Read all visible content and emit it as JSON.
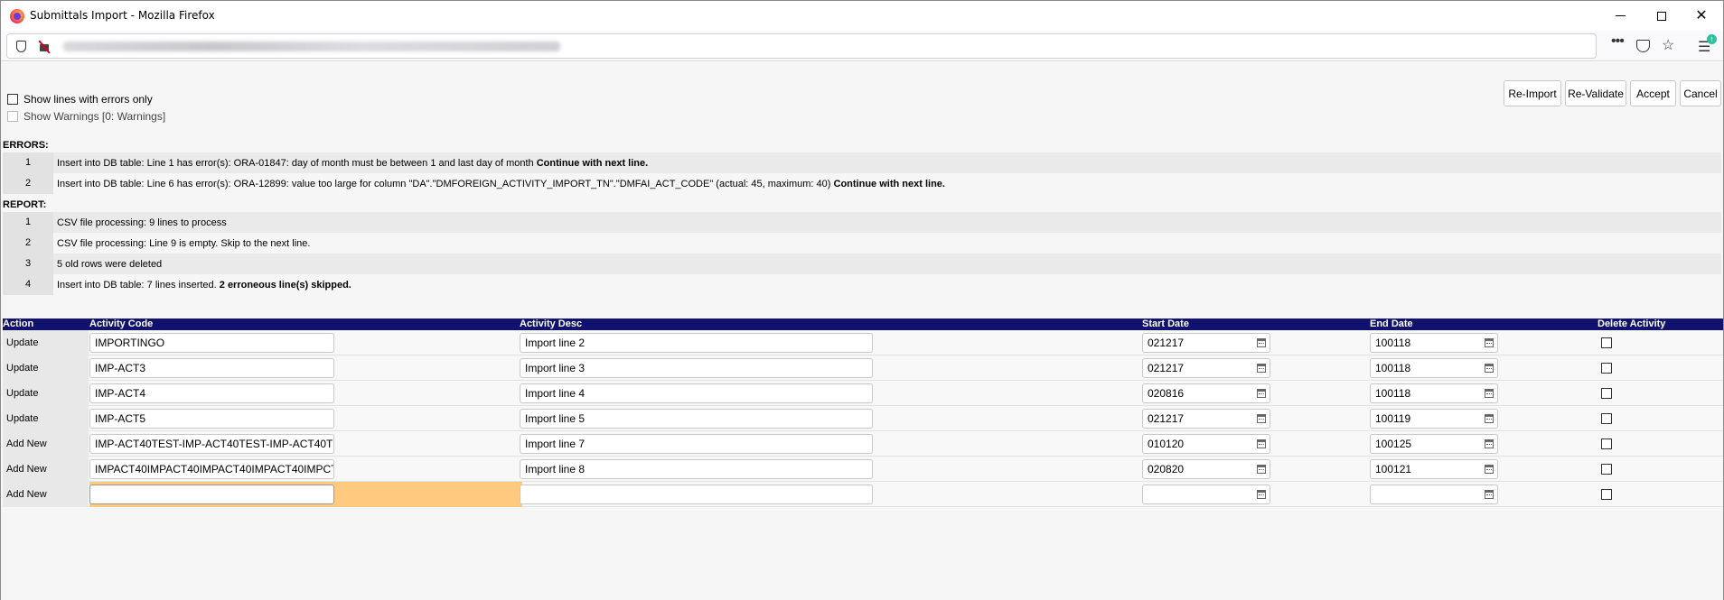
{
  "window": {
    "title": "Submittals Import - Mozilla Firefox"
  },
  "browser": {
    "icons": [
      "shield-icon",
      "insecure-lock-icon",
      "more-icon",
      "pocket-icon",
      "star-icon",
      "menu-icon"
    ]
  },
  "options": {
    "show_errors_only": "Show lines with errors only",
    "show_warnings": "Show Warnings [0: Warnings]"
  },
  "buttons": {
    "reimport": "Re-Import",
    "revalidate": "Re-Validate",
    "accept": "Accept",
    "cancel": "Cancel"
  },
  "errors": {
    "header": "ERRORS:",
    "rows": [
      {
        "num": "1",
        "text": "Insert into DB table: Line  1 has error(s): ORA-01847: day of month must be between 1 and last day of month ",
        "bold": "Continue with next line."
      },
      {
        "num": "2",
        "text": "Insert into DB table: Line  6 has error(s): ORA-12899: value too large for column \"DA\".\"DMFOREIGN_ACTIVITY_IMPORT_TN\".\"DMFAI_ACT_CODE\" (actual: 45, maximum: 40) ",
        "bold": "Continue with next line."
      }
    ]
  },
  "report": {
    "header": "REPORT:",
    "rows": [
      {
        "num": "1",
        "text": "CSV file processing: 9 lines to process",
        "bold": ""
      },
      {
        "num": "2",
        "text": "CSV file processing: Line  9 is empty. Skip to the next line.",
        "bold": ""
      },
      {
        "num": "3",
        "text": "5 old rows were deleted",
        "bold": ""
      },
      {
        "num": "4",
        "text": "Insert into DB table: 7 lines inserted. ",
        "bold": "2 erroneous line(s) skipped."
      }
    ]
  },
  "grid": {
    "columns": {
      "action": "Action",
      "code": "Activity Code",
      "desc": "Activity Desc",
      "start": "Start Date",
      "end": "End Date",
      "delete": "Delete Activity"
    },
    "rows": [
      {
        "action": "Update",
        "code": "IMPORTINGO",
        "desc": "Import line 2",
        "start": "021217",
        "end": "100118"
      },
      {
        "action": "Update",
        "code": "IMP-ACT3",
        "desc": "Import line 3",
        "start": "021217",
        "end": "100118"
      },
      {
        "action": "Update",
        "code": "IMP-ACT4",
        "desc": "Import line 4",
        "start": "020816",
        "end": "100118"
      },
      {
        "action": "Update",
        "code": "IMP-ACT5",
        "desc": "Import line 5",
        "start": "021217",
        "end": "100119"
      },
      {
        "action": "Add New",
        "code": "IMP-ACT40TEST-IMP-ACT40TEST-IMP-ACT40T",
        "desc": "Import line 7",
        "start": "010120",
        "end": "100125"
      },
      {
        "action": "Add New",
        "code": "IMPACT40IMPACT40IMPACT40IMPACT40IMPCT",
        "desc": "Import line 8",
        "start": "020820",
        "end": "100121"
      },
      {
        "action": "Add New",
        "code": "",
        "desc": "",
        "start": "",
        "end": ""
      }
    ]
  },
  "colors": {
    "grid_header": "#11116e",
    "highlight": "#ffc980"
  }
}
